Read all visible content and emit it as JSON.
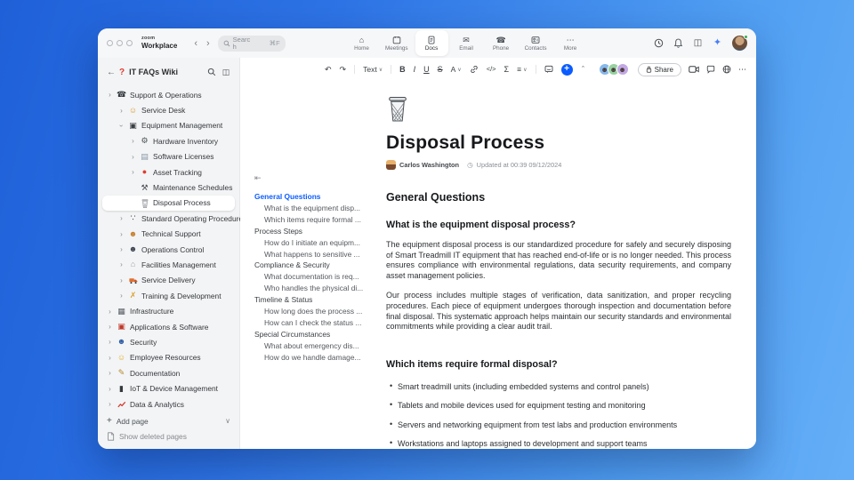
{
  "header": {
    "logo_top": "zoom",
    "logo_bottom": "Workplace",
    "search": {
      "placeholder": "Search",
      "shortcut": "⌘F"
    },
    "tabs": [
      {
        "label": "Home",
        "icon": "home-icon",
        "active": false
      },
      {
        "label": "Meetings",
        "icon": "calendar-icon",
        "active": false
      },
      {
        "label": "Docs",
        "icon": "document-icon",
        "active": true
      },
      {
        "label": "Email",
        "icon": "email-icon",
        "active": false
      },
      {
        "label": "Phone",
        "icon": "phone-icon",
        "active": false
      },
      {
        "label": "Contacts",
        "icon": "contacts-icon",
        "active": false
      },
      {
        "label": "More",
        "icon": "more-icon",
        "active": false
      }
    ]
  },
  "sidebar": {
    "title": "IT FAQs Wiki",
    "items": [
      {
        "label": "Support & Operations",
        "icon": "telephone-icon",
        "level": 0,
        "chevron": "right",
        "selected": false
      },
      {
        "label": "Service Desk",
        "icon": "service-person-icon",
        "level": 1,
        "chevron": "right",
        "selected": false
      },
      {
        "label": "Equipment Management",
        "icon": "monitor-icon",
        "level": 1,
        "chevron": "down",
        "selected": false
      },
      {
        "label": "Hardware Inventory",
        "icon": "mechanical-arm-icon",
        "level": 2,
        "chevron": "right",
        "selected": false
      },
      {
        "label": "Software Licenses",
        "icon": "software-disk-icon",
        "level": 2,
        "chevron": "right",
        "selected": false
      },
      {
        "label": "Asset Tracking",
        "icon": "location-pin-icon",
        "level": 2,
        "chevron": "right",
        "selected": false
      },
      {
        "label": "Maintenance Schedules",
        "icon": "hammer-wrench-icon",
        "level": 2,
        "chevron": null,
        "selected": false
      },
      {
        "label": "Disposal Process",
        "icon": "wastebasket-icon",
        "level": 2,
        "chevron": null,
        "selected": true
      },
      {
        "label": "Standard Operating Procedures",
        "icon": "footprints-icon",
        "level": 1,
        "chevron": "right",
        "selected": false
      },
      {
        "label": "Technical Support",
        "icon": "worker-icon",
        "level": 1,
        "chevron": "right",
        "selected": false
      },
      {
        "label": "Operations Control",
        "icon": "guard-icon",
        "level": 1,
        "chevron": "right",
        "selected": false
      },
      {
        "label": "Facilities Management",
        "icon": "building-house-icon",
        "level": 1,
        "chevron": "right",
        "selected": false
      },
      {
        "label": "Service Delivery",
        "icon": "delivery-truck-icon",
        "level": 1,
        "chevron": "right",
        "selected": false
      },
      {
        "label": "Training & Development",
        "icon": "training-icon",
        "level": 1,
        "chevron": "right",
        "selected": false
      },
      {
        "label": "Infrastructure",
        "icon": "infrastructure-icon",
        "level": 0,
        "chevron": "right",
        "selected": false
      },
      {
        "label": "Applications & Software",
        "icon": "toolbox-icon",
        "level": 0,
        "chevron": "right",
        "selected": false
      },
      {
        "label": "Security",
        "icon": "police-officer-icon",
        "level": 0,
        "chevron": "right",
        "selected": false
      },
      {
        "label": "Employee Resources",
        "icon": "employee-icon",
        "level": 0,
        "chevron": "right",
        "selected": false
      },
      {
        "label": "Documentation",
        "icon": "pencil-icon",
        "level": 0,
        "chevron": "right",
        "selected": false
      },
      {
        "label": "IoT & Device Management",
        "icon": "mobile-device-icon",
        "level": 0,
        "chevron": "right",
        "selected": false
      },
      {
        "label": "Data & Analytics",
        "icon": "chart-up-icon",
        "level": 0,
        "chevron": "right",
        "selected": false
      }
    ],
    "add_page": "Add page",
    "show_deleted": "Show deleted pages"
  },
  "toolbar": {
    "text_style": "Text",
    "format": {
      "bold": "B",
      "italic": "I",
      "underline": "U",
      "strike": "S",
      "color": "A",
      "code": "</>",
      "formula": "Σ"
    },
    "share_label": "Share",
    "collaborator_colors": [
      "#86b9ea",
      "#97d1a0",
      "#c2a8e3"
    ]
  },
  "toc": {
    "sections": [
      {
        "label": "General Questions",
        "active": true,
        "children": [
          "What is the equipment disp...",
          "Which items require formal ..."
        ]
      },
      {
        "label": "Process Steps",
        "active": false,
        "children": [
          "How do I initiate an equipm...",
          "What happens to sensitive ..."
        ]
      },
      {
        "label": "Compliance & Security",
        "active": false,
        "children": [
          "What documentation is req...",
          "Who handles the physical di..."
        ]
      },
      {
        "label": "Timeline & Status",
        "active": false,
        "children": [
          "How long does the process ...",
          "How can I check the status ..."
        ]
      },
      {
        "label": "Special Circumstances",
        "active": false,
        "children": [
          "What about emergency dis...",
          "How do we handle damage..."
        ]
      }
    ]
  },
  "doc": {
    "title": "Disposal Process",
    "author": "Carlos Washington",
    "updated": "Updated at 00:39 09/12/2024",
    "section_heading": "General Questions",
    "q1_heading": "What is the equipment disposal process?",
    "q1_p1": "The equipment disposal process is our standardized procedure for safely and securely disposing of Smart Treadmill IT equipment that has reached end-of-life or is no longer needed. This process ensures compliance with environmental regulations, data security requirements, and company asset management policies.",
    "q1_p2": "Our process includes multiple stages of verification, data sanitization, and proper recycling procedures. Each piece of equipment undergoes thorough inspection and documentation before final disposal. This systematic approach helps maintain our security standards and environmental commitments while providing a clear audit trail.",
    "q2_heading": "Which items require formal disposal?",
    "q2_bullets": [
      "Smart treadmill units (including embedded systems and control panels)",
      "Tablets and mobile devices used for equipment testing and monitoring",
      "Servers and networking equipment from test labs and production environments",
      "Workstations and laptops assigned to development and support teams"
    ]
  },
  "accent_colors": {
    "zoom_blue": "#0b5cff",
    "toc_active": "#0b5cff",
    "wiki_help_red": "#e03c31"
  }
}
